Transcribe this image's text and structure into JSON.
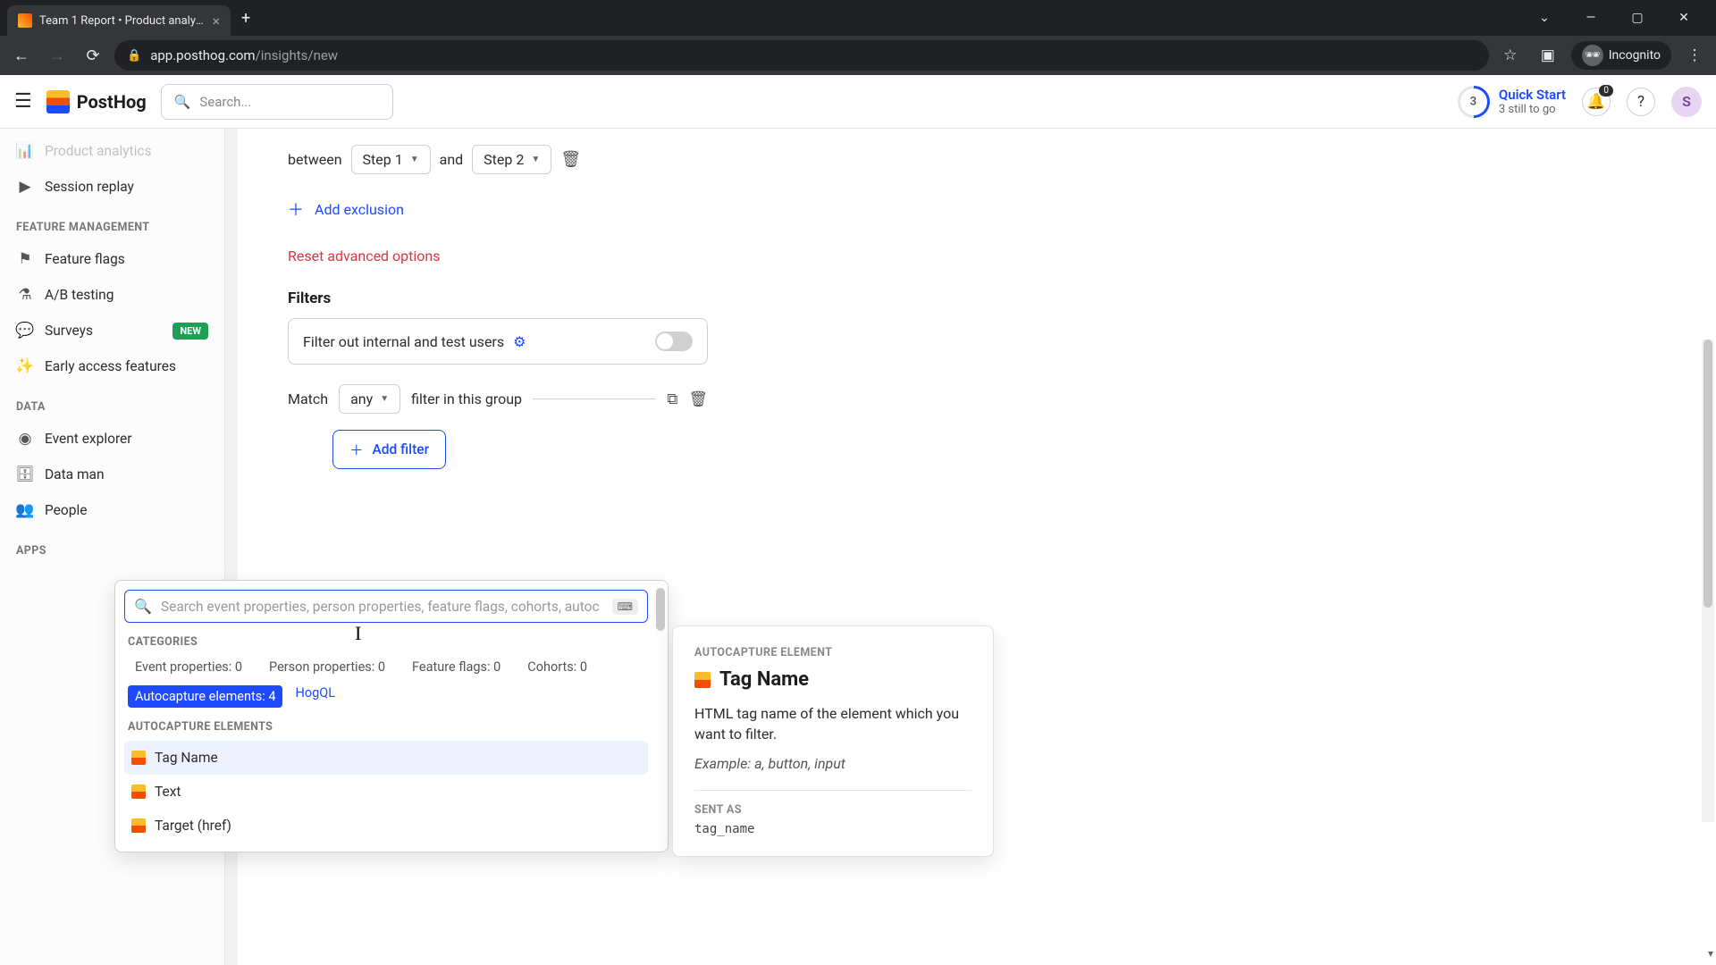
{
  "browser": {
    "tab_title": "Team 1 Report • Product analytic",
    "url_domain": "app.posthog.com",
    "url_path": "/insights/new",
    "incognito_label": "Incognito"
  },
  "header": {
    "logo_text": "PostHog",
    "search_placeholder": "Search...",
    "quickstart_title": "Quick Start",
    "quickstart_sub": "3 still to go",
    "quickstart_n": "3",
    "bell_badge": "0",
    "avatar_letter": "S"
  },
  "sidebar": {
    "cut_item": "Product analytics",
    "session_replay": "Session replay",
    "section_feature": "FEATURE MANAGEMENT",
    "feature_flags": "Feature flags",
    "ab_testing": "A/B testing",
    "surveys": "Surveys",
    "surveys_badge": "NEW",
    "early_access": "Early access features",
    "section_data": "DATA",
    "event_explorer": "Event explorer",
    "data_management": "Data man",
    "people": "People",
    "section_apps": "APPS"
  },
  "editor": {
    "between": "between",
    "step1": "Step 1",
    "and": "and",
    "step2": "Step 2",
    "add_exclusion": "Add exclusion",
    "reset_advanced": "Reset advanced options",
    "filters_title": "Filters",
    "filter_internal": "Filter out internal and test users",
    "match": "Match",
    "match_any": "any",
    "match_suffix": "filter in this group",
    "add_filter": "Add filter"
  },
  "dropdown": {
    "search_placeholder": "Search event properties, person properties, feature flags, cohorts, autoc",
    "section_categories": "CATEGORIES",
    "cat_event": "Event properties: 0",
    "cat_person": "Person properties: 0",
    "cat_ff": "Feature flags: 0",
    "cat_cohorts": "Cohorts: 0",
    "cat_auto": "Autocapture elements: 4",
    "hogql": "HogQL",
    "section_elements": "AUTOCAPTURE ELEMENTS",
    "items": [
      "Tag Name",
      "Text",
      "Target (href)"
    ]
  },
  "info": {
    "eyebrow": "AUTOCAPTURE ELEMENT",
    "title": "Tag Name",
    "desc": "HTML tag name of the element which you want to filter.",
    "example": "Example: a, button, input",
    "sent_as_label": "SENT AS",
    "sent_as_value": "tag_name"
  }
}
